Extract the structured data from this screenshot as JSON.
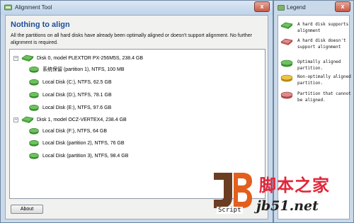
{
  "window": {
    "title": "Alignment Tool",
    "close_label": "x"
  },
  "header": {
    "heading": "Nothing to align",
    "description": "All the partitions on all hard disks have already been optimally aligned or doesn't support alignment. No further alignment is required."
  },
  "tree": {
    "expand_symbol": "−",
    "disks": [
      {
        "label": "Disk 0, model PLEXTOR PX-256M5S, 238.4 GB",
        "partitions": [
          "系统保留 (partition 1), NTFS, 100 MB",
          "Local Disk (C:), NTFS, 62.5 GB",
          "Local Disk (D:), NTFS, 78.1 GB",
          "Local Disk (E:), NTFS, 97.6 GB"
        ]
      },
      {
        "label": "Disk 1, model OCZ-VERTEX4, 238.4 GB",
        "partitions": [
          "Local Disk (F:), NTFS, 64 GB",
          "Local Disk (partition 2), NTFS, 76 GB",
          "Local Disk (partition 3), NTFS, 98.4 GB"
        ]
      }
    ]
  },
  "buttons": {
    "about": "About"
  },
  "legend": {
    "title": "Legend",
    "items": [
      {
        "text": "A hard disk supports alignment",
        "icon": "disk-supported-icon",
        "color": "#52b848"
      },
      {
        "text": "A hard disk doesn't support alignment",
        "icon": "disk-unsupported-icon",
        "color": "#d96a6a"
      },
      {
        "text": "Optimally aligned partition.",
        "icon": "partition-aligned-icon",
        "color": "#52b848"
      },
      {
        "text": "Non-optimally aligned partition.",
        "icon": "partition-not-aligned-icon",
        "color": "#e2b52a"
      },
      {
        "text": "Partition that cannot be aligned.",
        "icon": "partition-cannot-align-icon",
        "color": "#d96a6a"
      }
    ]
  },
  "watermark": {
    "cn": "脚本之家",
    "url": "jb51.net",
    "script": "Script"
  }
}
